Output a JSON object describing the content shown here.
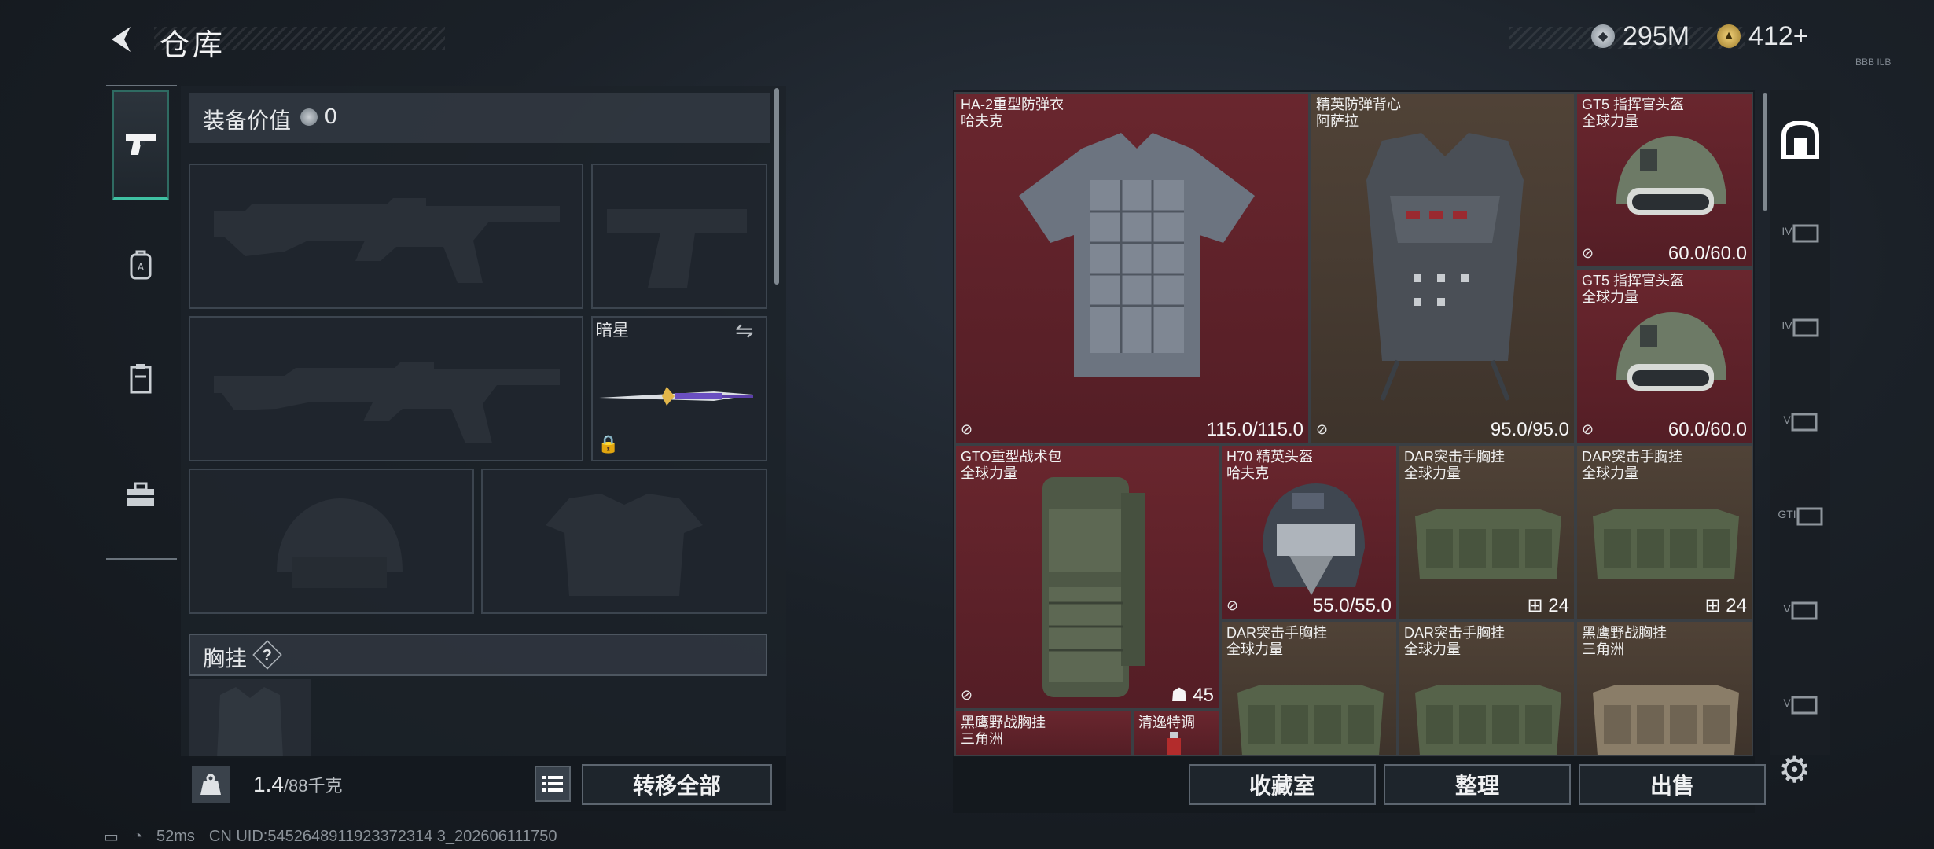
{
  "header": {
    "title": "仓库",
    "back_icon": "back-arrow-icon"
  },
  "currency": {
    "silver": "295M",
    "gold": "412+",
    "tag": "BBB ILB"
  },
  "sidebar": {
    "items": [
      {
        "icon": "pistol-icon"
      },
      {
        "icon": "backpack-icon"
      },
      {
        "icon": "locker-icon"
      },
      {
        "icon": "toolbox-icon"
      }
    ]
  },
  "loadout": {
    "value_label": "装备价值",
    "value": "0",
    "knife_name": "暗星",
    "chest_label": "胸挂",
    "chest_help": "?",
    "weight_current": "1.4",
    "weight_max": "/88千克",
    "transfer_all": "转移全部"
  },
  "storage": {
    "items": [
      {
        "line1": "HA-2重型防弹衣",
        "line2": "哈夫克",
        "value": "115.0/115.0",
        "rarity": "red"
      },
      {
        "line1": "精英防弹背心",
        "line2": "阿萨拉",
        "value": "95.0/95.0",
        "rarity": "brown"
      },
      {
        "line1": "GT5 指挥官头盔",
        "line2": "全球力量",
        "value": "60.0/60.0",
        "rarity": "red"
      },
      {
        "line1": "GT5 指挥官头盔",
        "line2": "全球力量",
        "value": "60.0/60.0",
        "rarity": "red"
      },
      {
        "line1": "GTO重型战术包",
        "line2": "全球力量",
        "value": "45",
        "rarity": "red"
      },
      {
        "line1": "H70 精英头盔",
        "line2": "哈夫克",
        "value": "55.0/55.0",
        "rarity": "red"
      },
      {
        "line1": "DAR突击手胸挂",
        "line2": "全球力量",
        "value": "24",
        "rarity": "brown"
      },
      {
        "line1": "DAR突击手胸挂",
        "line2": "全球力量",
        "value": "24",
        "rarity": "brown"
      },
      {
        "line1": "DAR突击手胸挂",
        "line2": "全球力量",
        "value": "",
        "rarity": "brown"
      },
      {
        "line1": "DAR突击手胸挂",
        "line2": "全球力量",
        "value": "",
        "rarity": "brown"
      },
      {
        "line1": "黑鹰野战胸挂",
        "line2": "三角洲",
        "value": "",
        "rarity": "brown"
      },
      {
        "line1": "黑鹰野战胸挂",
        "line2": "三角洲",
        "value": "",
        "rarity": "red"
      },
      {
        "line1": "清逸特调",
        "line2": "",
        "value": "",
        "rarity": "red"
      }
    ],
    "buttons": {
      "collection": "收藏室",
      "tidy": "整理",
      "sell": "出售"
    }
  },
  "right_tabs": [
    "home-icon",
    "IV",
    "IV",
    "V",
    "GTI",
    "V",
    "V"
  ],
  "status": {
    "ping": "52ms",
    "uid": "CN UID:5452648911923372314 3_202606111750"
  },
  "colors": {
    "red_rarity": "#7a2832",
    "brown_rarity": "#58483a",
    "accent": "#3fc1a3"
  }
}
